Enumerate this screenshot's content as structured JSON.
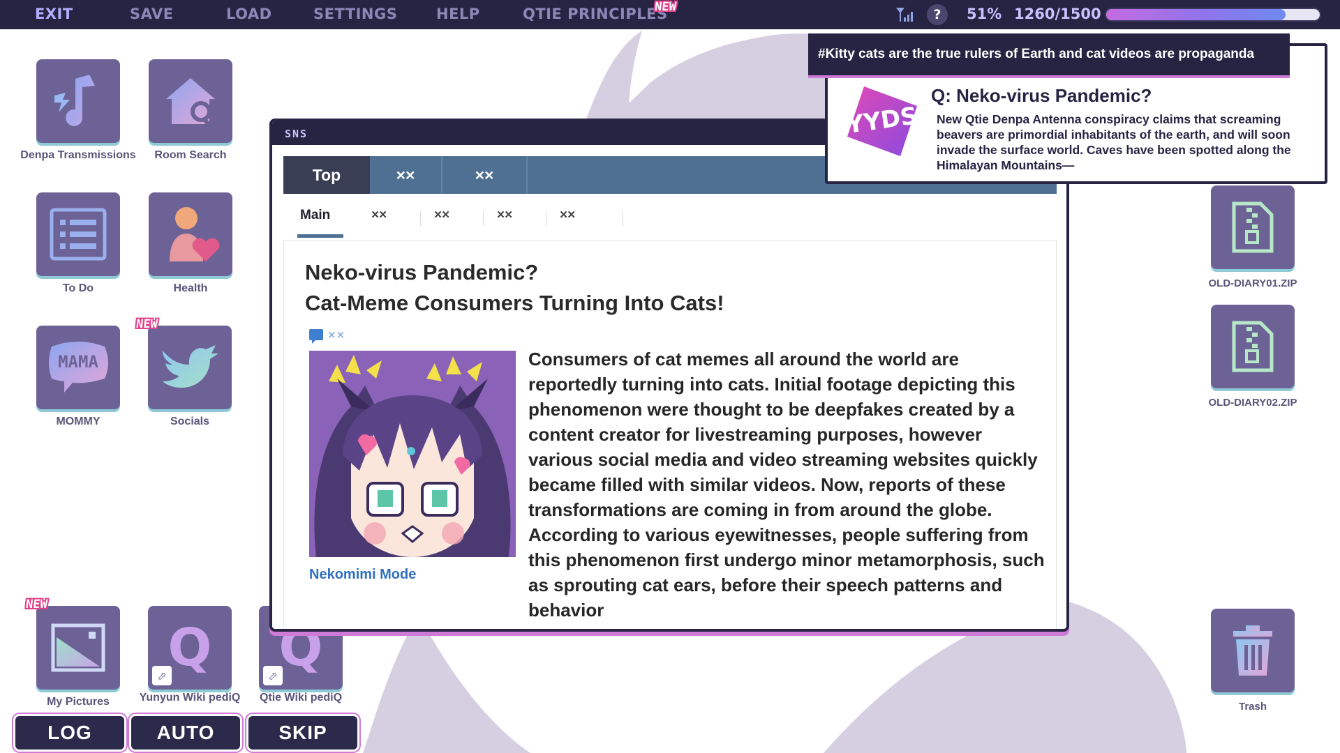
{
  "menu": {
    "items": [
      "EXIT",
      "SAVE",
      "LOAD",
      "SETTINGS",
      "HELP",
      "QTIE PRINCIPLES"
    ],
    "new_badge": "NEW"
  },
  "status": {
    "help_label": "?",
    "percent": "51%",
    "count": "1260/1500",
    "progress_fraction": 0.84
  },
  "desktop": {
    "icons": [
      {
        "label": "Denpa Transmissions",
        "icon": "music-note-icon"
      },
      {
        "label": "Room Search",
        "icon": "house-search-icon"
      },
      {
        "label": "To Do",
        "icon": "list-icon"
      },
      {
        "label": "Health",
        "icon": "person-heart-icon"
      },
      {
        "label": "MOMMY",
        "icon": "mama-bubble-icon",
        "bubble_text": "MAMA"
      },
      {
        "label": "Socials",
        "icon": "bird-icon",
        "badge": "NEW"
      },
      {
        "label": "My Pictures",
        "icon": "picture-icon",
        "badge": "NEW"
      },
      {
        "label": "Yunyun Wiki pediQ",
        "icon": "q-icon",
        "q_letter": "Q"
      },
      {
        "label": "Qtie Wiki pediQ",
        "icon": "q-icon",
        "q_letter": "Q"
      }
    ]
  },
  "bottom_buttons": {
    "log": "LOG",
    "auto": "AUTO",
    "skip": "SKIP"
  },
  "sns": {
    "window_title": "SNS",
    "top_tabs": [
      "Top",
      "××",
      "××"
    ],
    "sub_tabs": [
      "Main",
      "××",
      "××",
      "××",
      "××"
    ],
    "article": {
      "title_line1": "Neko-virus Pandemic?",
      "title_line2": "Cat-Meme Consumers Turning Into Cats!",
      "comment_count": "××",
      "image_caption": "Nekomimi Mode",
      "body": "Consumers of cat memes all around the world are reportedly turning into cats. Initial footage depicting this phenomenon were thought to be deepfakes created by a content creator for livestreaming purposes, however various social media and video streaming websites quickly became filled with similar videos. Now, reports of these transformations are coming in from around the globe. According to various eyewitnesses, people suffering from this phenomenon first undergo minor metamorphosis, such as sprouting cat ears, before their speech patterns and behavior"
    }
  },
  "notification": {
    "hashtag": "#Kitty cats are the true rulers of Earth and cat videos are propaganda",
    "logo_text": "YYDS",
    "title": "Q: Neko-virus Pandemic?",
    "body": "New Qtie Denpa Antenna conspiracy claims that screaming beavers are primordial inhabitants of the earth, and will soon invade the surface world. Caves have been spotted along the Himalayan Mountains—"
  },
  "files": [
    {
      "label": "OLD-DIARY01.ZIP"
    },
    {
      "label": "OLD-DIARY02.ZIP"
    },
    {
      "label": "Trash"
    }
  ],
  "colors": {
    "bar_bg": "#262442",
    "icon_tile": "#6d6296",
    "accent_pink": "#d07ad8",
    "tab_blue": "#4f6f93",
    "link_blue": "#2f6fc0"
  }
}
